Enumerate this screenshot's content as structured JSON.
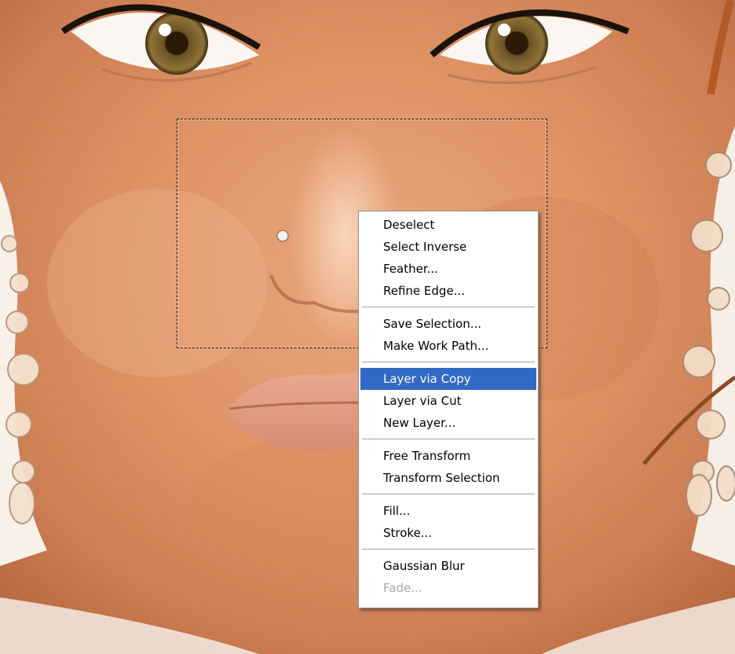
{
  "colors": {
    "highlight": "#316ac5",
    "disabled_text": "#a7a7a7",
    "menu_background": "#ffffff"
  },
  "context_menu": {
    "groups": [
      [
        "Deselect",
        "Select Inverse",
        "Feather...",
        "Refine Edge..."
      ],
      [
        "Save Selection...",
        "Make Work Path..."
      ],
      [
        "Layer via Copy",
        "Layer via Cut",
        "New Layer..."
      ],
      [
        "Free Transform",
        "Transform Selection"
      ],
      [
        "Fill...",
        "Stroke..."
      ],
      [
        "Gaussian Blur",
        "Fade..."
      ]
    ],
    "selected_item": "Layer via Copy",
    "disabled_items": [
      "Fade..."
    ]
  }
}
